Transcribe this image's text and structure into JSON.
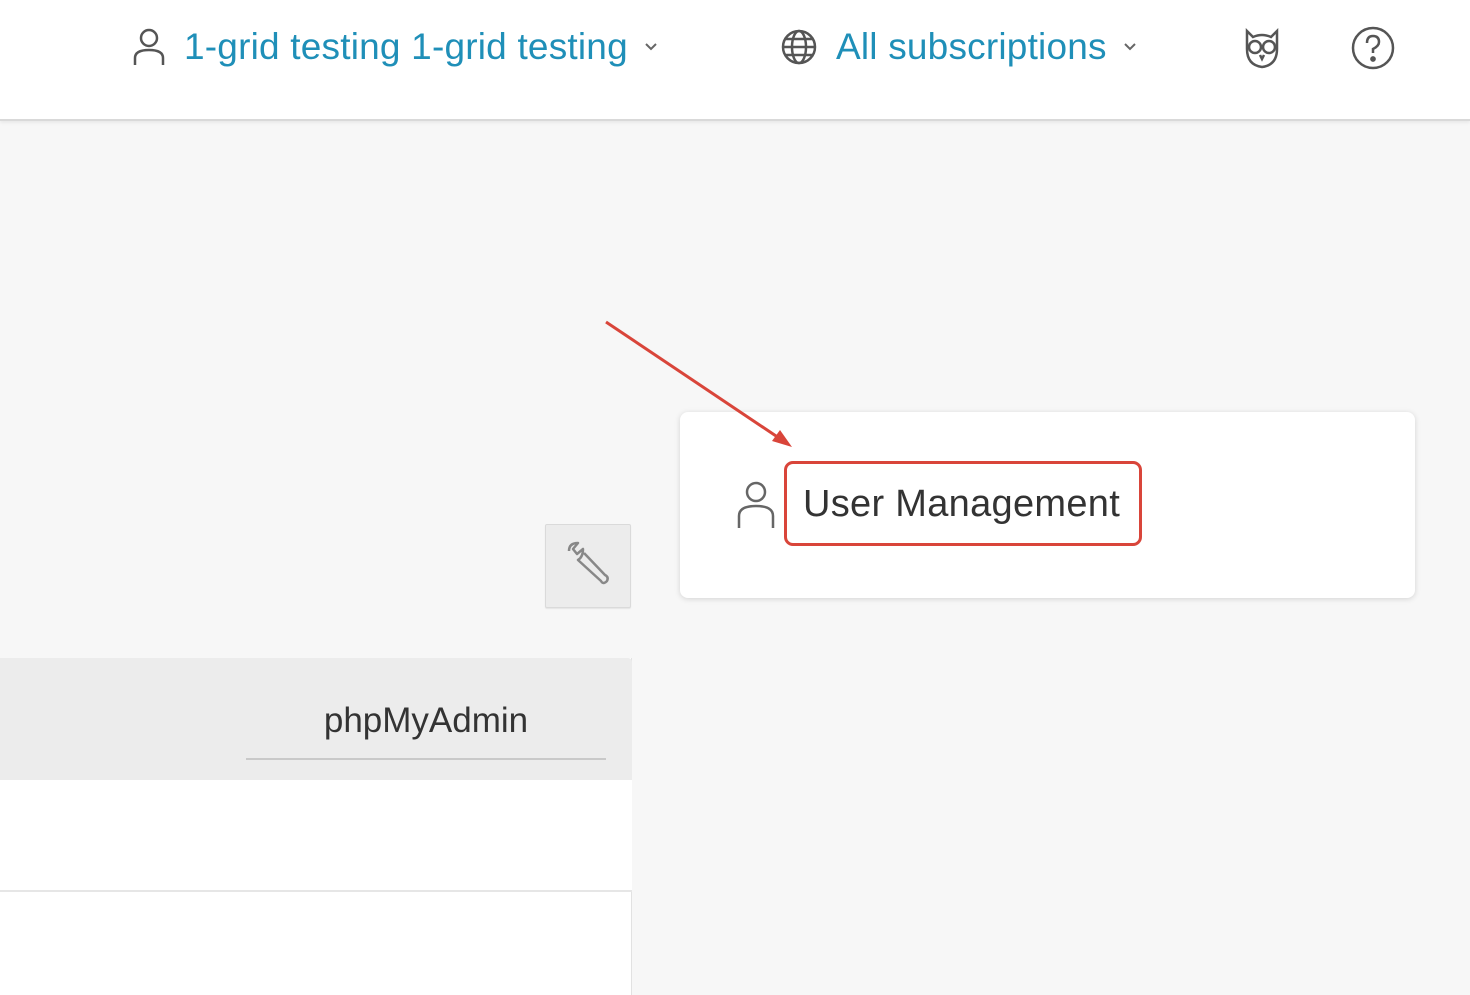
{
  "header": {
    "user_menu": {
      "label": "1-grid testing 1-grid testing",
      "icon": "user-icon"
    },
    "subscriptions_menu": {
      "label": "All subscriptions",
      "icon": "globe-icon"
    },
    "owl_icon": "owl-icon",
    "help_icon": "help-icon",
    "accent_color": "#1f8fb8"
  },
  "toolbar": {
    "wrench_icon": "wrench-icon"
  },
  "panel": {
    "tab_label": "phpMyAdmin"
  },
  "card": {
    "icon": "user-icon",
    "label": "User Management"
  },
  "annotation": {
    "color": "#d9453a"
  }
}
